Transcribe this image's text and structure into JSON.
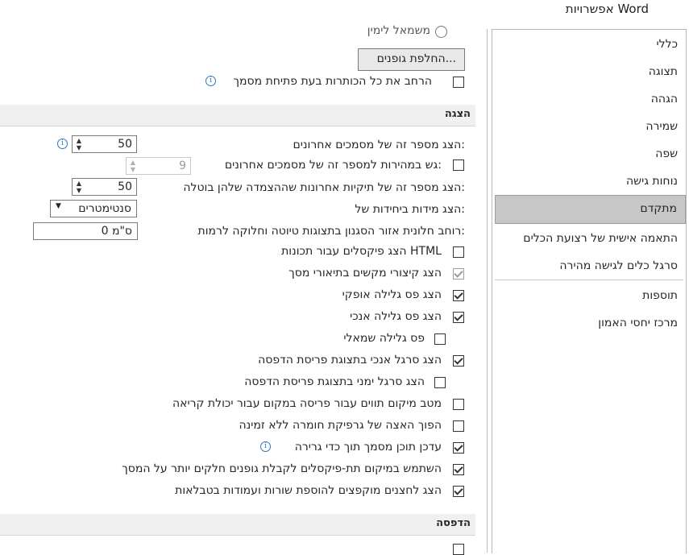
{
  "window": {
    "title": "אפשרויות Word"
  },
  "nav": {
    "items": [
      "כללי",
      "תצוגה",
      "הגהה",
      "שמירה",
      "שפה",
      "נוחות גישה",
      "מתקדם",
      "התאמה אישית של רצועת הכלים",
      "סרגל כלים לגישה מהירה",
      "תוספות",
      "מרכז יחסי האמון"
    ],
    "selected": "מתקדם"
  },
  "top": {
    "radio_label": "משמאל לימין",
    "font_sub_button": "החלפת גופנים...",
    "expand_headings_label": "הרחב את כל הכותרות בעת פתיחת מסמך"
  },
  "display": {
    "section_title": "הצגה",
    "recent_docs_label": "הצג מספר זה של מסמכים אחרונים:",
    "recent_docs_value": "50",
    "quick_access_label": "גש במהירות למספר זה של מסמכים אחרונים:",
    "quick_access_value": "9",
    "recent_folders_label": "הצג מספר זה של תיקיות אחרונות שההצמדה שלהן בוטלה:",
    "recent_folders_value": "50",
    "units_label": "הצג מידות ביחידות של:",
    "units_value": "סנטימטרים",
    "style_width_label": "רוחב חלונית אזור הסגנון בתצוגות טיוטה וחלוקה לרמות:",
    "style_width_value": "0 ס\"מ",
    "options": [
      {
        "label": "הצג פיקסלים עבור תכונות HTML",
        "checked": false
      },
      {
        "label": "הצג קיצורי מקשים בתיאורי מסך",
        "checked": true,
        "disabled": true
      },
      {
        "label": "הצג פס גלילה אופקי",
        "checked": true
      },
      {
        "label": "הצג פס גלילה אנכי",
        "checked": true
      },
      {
        "label": "פס גלילה שמאלי",
        "checked": false
      },
      {
        "label": "הצג סרגל אנכי בתצוגת פריסת הדפסה",
        "checked": true
      },
      {
        "label": "הצג סרגל ימני בתצוגת פריסת הדפסה",
        "checked": false
      },
      {
        "label": "מטב מיקום תווים עבור פריסה במקום עבור יכולת קריאה",
        "checked": false
      },
      {
        "label": "הפוך האצה של גרפיקת חומרה ללא זמינה",
        "checked": false
      },
      {
        "label": "עדכן תוכן מסמך תוך כדי גרירה",
        "checked": true
      },
      {
        "label": "השתמש במיקום תת-פיקסלים לקבלת גופנים חלקים יותר על המסך",
        "checked": true
      },
      {
        "label": "הצג לחצנים מוקפצים להוספת שורות ועמודות בטבלאות",
        "checked": true
      }
    ]
  },
  "print": {
    "section_title": "הדפסה"
  },
  "colors": {
    "nav_selected_bg": "#c7c7c7",
    "section_bg": "#f0f0f0",
    "info_blue": "#2e75c4"
  },
  "icons": {
    "info": "info-icon",
    "spin": "spin-arrows-icon",
    "dropdown": "chevron-down-icon"
  }
}
